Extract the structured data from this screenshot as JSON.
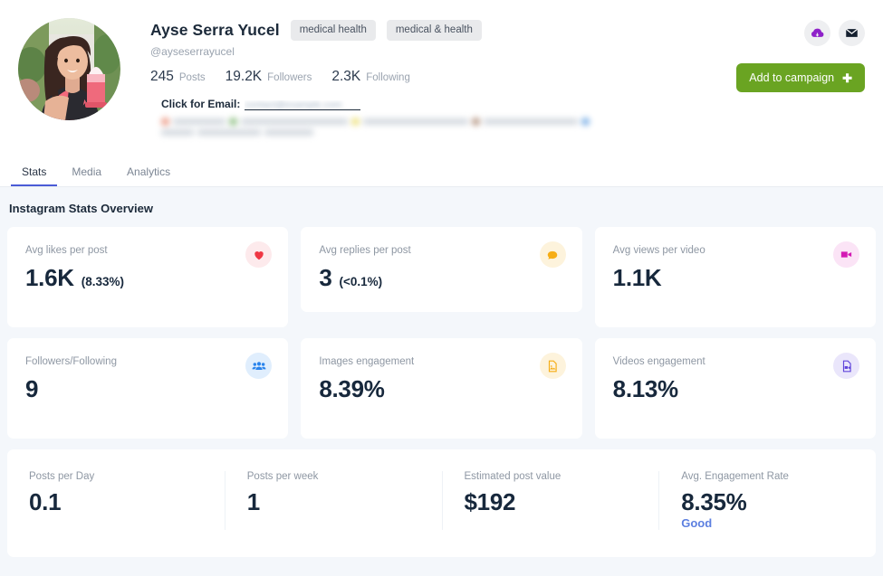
{
  "profile": {
    "name": "Ayse Serra Yucel",
    "handle": "@ayseserrayucel",
    "avatar_alt": "profile-photo",
    "tags": [
      "medical health",
      "medical & health"
    ],
    "counts": [
      {
        "value": "245",
        "label": "Posts"
      },
      {
        "value": "19.2K",
        "label": "Followers"
      },
      {
        "value": "2.3K",
        "label": "Following"
      }
    ],
    "email_label": "Click for Email:",
    "email_redacted": "contact@example.com",
    "actions": {
      "download_icon": "cloud-download-icon",
      "mail_icon": "mail-icon",
      "campaign_label": "Add to campaign",
      "campaign_plus": "✚"
    }
  },
  "tabs": [
    {
      "label": "Stats",
      "active": true
    },
    {
      "label": "Media",
      "active": false
    },
    {
      "label": "Analytics",
      "active": false
    }
  ],
  "section": {
    "title": "Instagram Stats Overview"
  },
  "cards": [
    {
      "label": "Avg likes per post",
      "value": "1.6K",
      "sub": "(8.33%)",
      "icon": "heart-icon",
      "icon_bg": "#fdeaec",
      "icon_color": "#ef3744",
      "tall": true
    },
    {
      "label": "Avg replies per post",
      "value": "3",
      "sub": "(<0.1%)",
      "icon": "comment-icon",
      "icon_bg": "#fdf3dc",
      "icon_color": "#f6ad15",
      "tall": false
    },
    {
      "label": "Avg views per video",
      "value": "1.1K",
      "sub": "",
      "icon": "video-icon",
      "icon_bg": "#fbe4f6",
      "icon_color": "#d31ab4",
      "tall": true
    },
    {
      "label": "Followers/Following",
      "value": "9",
      "sub": "",
      "icon": "users-icon",
      "icon_bg": "#e0eefd",
      "icon_color": "#2a84ec",
      "tall": true
    },
    {
      "label": "Images engagement",
      "value": "8.39%",
      "sub": "",
      "icon": "image-file-icon",
      "icon_bg": "#fdf3dc",
      "icon_color": "#f6ad15",
      "tall": true
    },
    {
      "label": "Videos engagement",
      "value": "8.13%",
      "sub": "",
      "icon": "video-file-icon",
      "icon_bg": "#eae6fb",
      "icon_color": "#6246db",
      "tall": true
    }
  ],
  "summary": [
    {
      "label": "Posts per Day",
      "value": "0.1",
      "note": ""
    },
    {
      "label": "Posts per week",
      "value": "1",
      "note": ""
    },
    {
      "label": "Estimated post value",
      "value": "$192",
      "note": ""
    },
    {
      "label": "Avg. Engagement Rate",
      "value": "8.35%",
      "note": "Good"
    }
  ],
  "colors": {
    "page_bg": "#f4f7fb",
    "accent_green": "#6aa422",
    "accent_blue": "#4a5bd6",
    "text_dark": "#17283c",
    "text_muted": "#8e97a3",
    "good_blue": "#5c7fe0"
  }
}
